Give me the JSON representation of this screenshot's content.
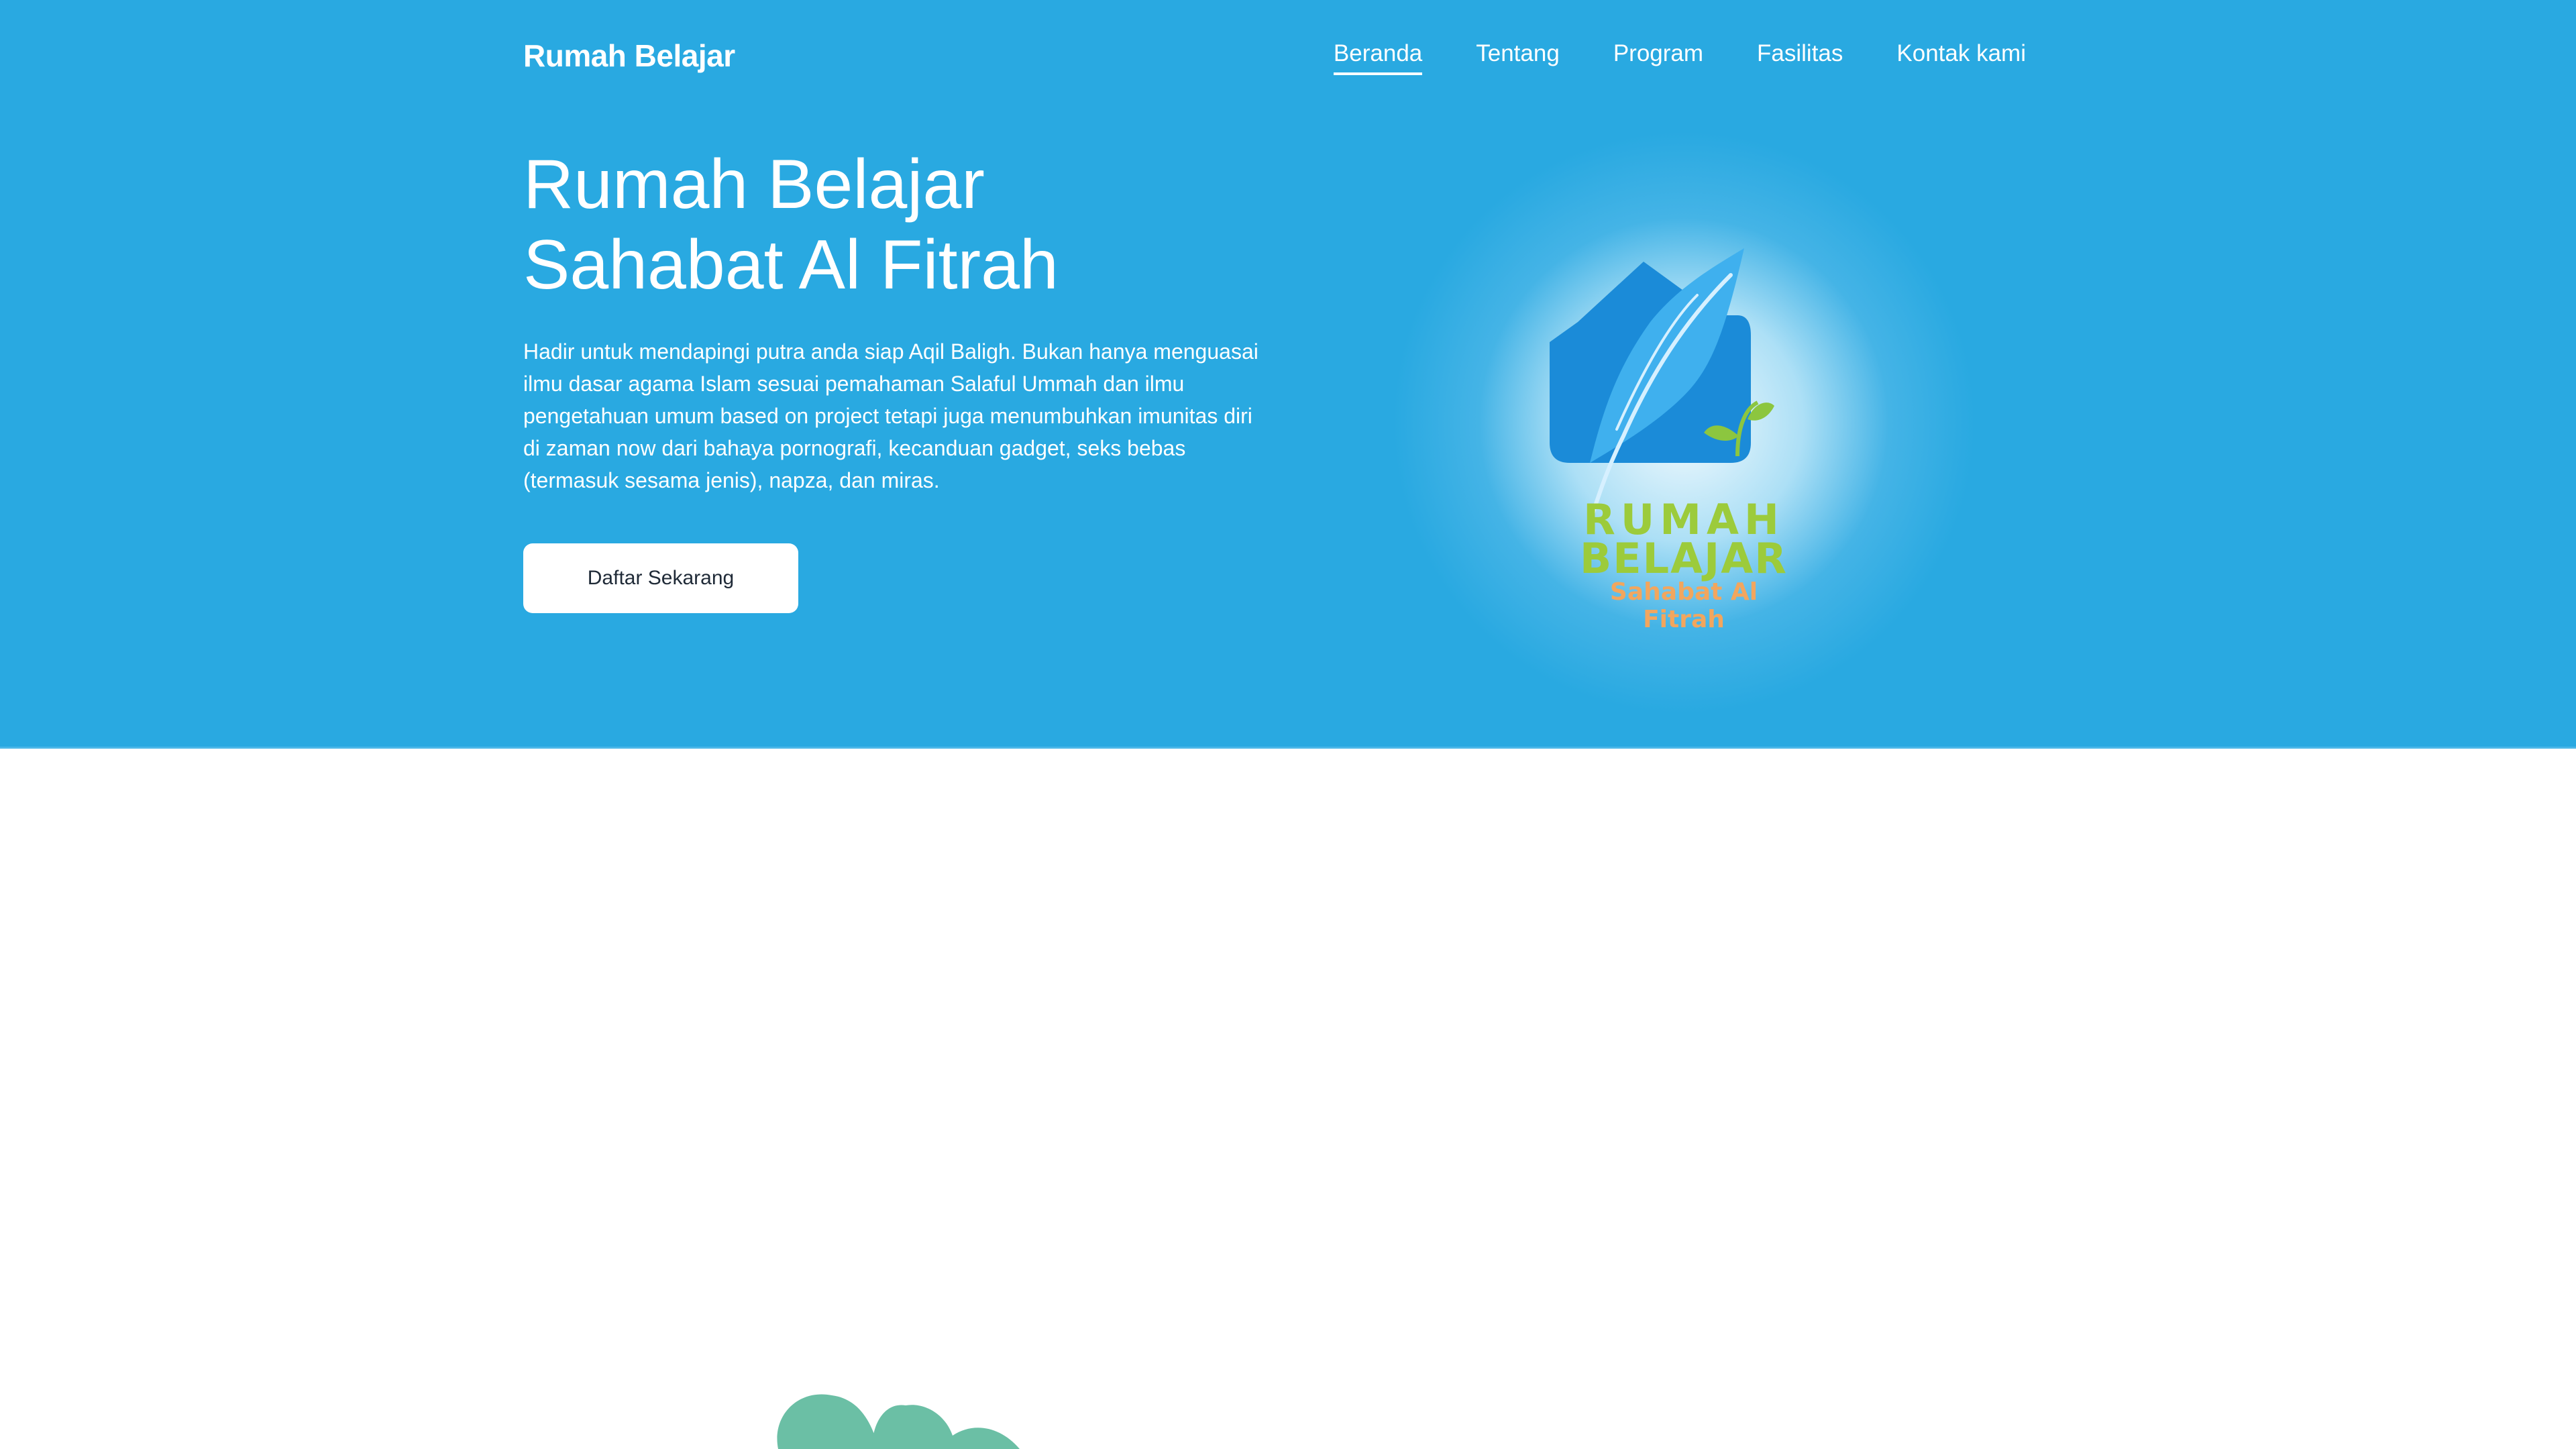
{
  "navbar": {
    "brand": "Rumah Belajar",
    "items": [
      {
        "label": "Beranda",
        "active": true
      },
      {
        "label": "Tentang",
        "active": false
      },
      {
        "label": "Program",
        "active": false
      },
      {
        "label": "Fasilitas",
        "active": false
      },
      {
        "label": "Kontak kami",
        "active": false
      }
    ]
  },
  "hero": {
    "title_line_1": "Rumah Belajar",
    "title_line_2": "Sahabat Al Fitrah",
    "description": "Hadir untuk mendapingi putra anda siap Aqil Baligh. Bukan hanya menguasai ilmu dasar agama Islam sesuai pemahaman Salaful Ummah dan ilmu pengetahuan umum based on project tetapi juga menumbuhkan imunitas diri di zaman now dari bahaya pornografi, kecanduan gadget, seks bebas (termasuk sesama jenis), napza, dan miras.",
    "cta_label": "Daftar Sekarang"
  },
  "logo": {
    "line_1": "RUMAH",
    "line_2": "BELAJAR",
    "line_3": "Sahabat Al Fitrah",
    "icon": "feather-house-icon"
  },
  "colors": {
    "primary": "#29a9e1",
    "logo_green": "#9ccb3b",
    "logo_orange": "#f2a65e",
    "decor_leaf": "#6bbfa5"
  }
}
